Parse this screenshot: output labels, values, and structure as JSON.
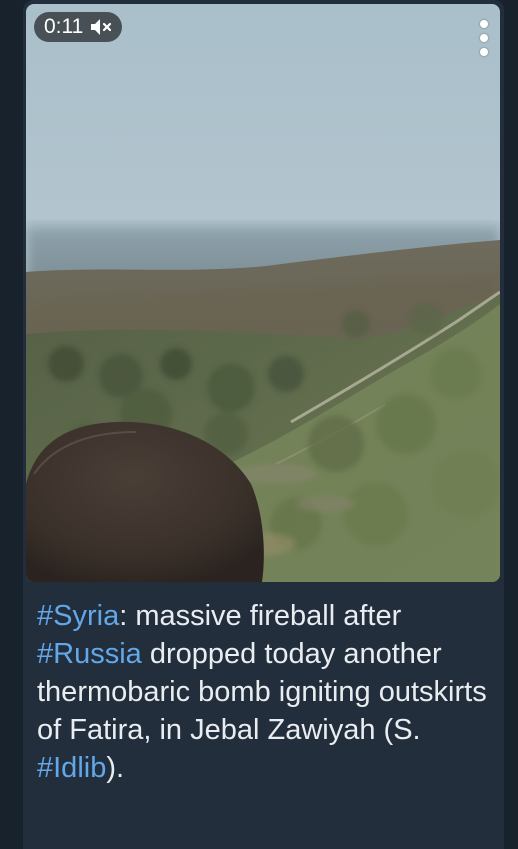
{
  "video": {
    "duration": "0:11",
    "muted": true,
    "icons": {
      "mute": "speaker-muted-icon",
      "menu": "more-vertical-icon"
    }
  },
  "caption": {
    "hashtag_1": "#Syria",
    "text_1": ": massive fireball after ",
    "hashtag_2": "#Russia",
    "text_2": " dropped today another thermobaric bomb igniting outskirts of Fatira, in Jebal Zawiyah (S. ",
    "hashtag_3": "#Idlib",
    "text_3": ")."
  },
  "colors": {
    "background": "#18222d",
    "bubble": "#222e3c",
    "hashtag": "#62a7e8",
    "text": "#e9edf1"
  }
}
